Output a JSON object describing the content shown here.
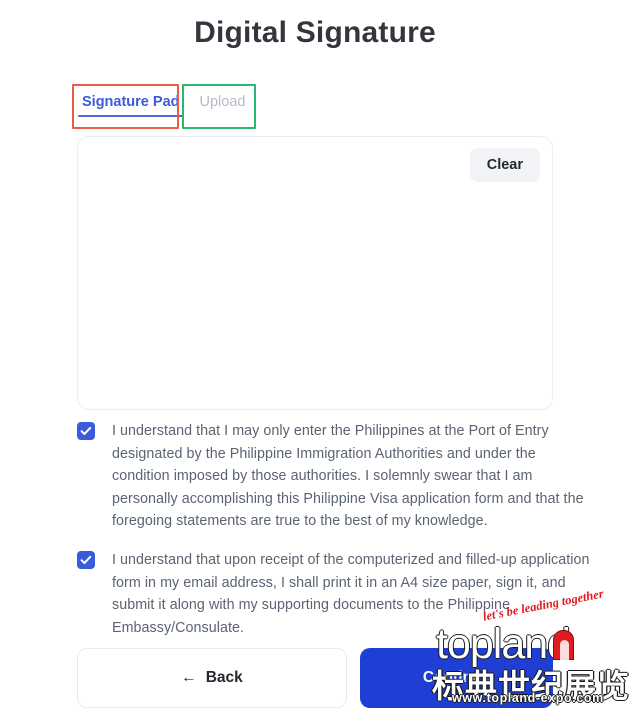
{
  "page": {
    "title": "Digital Signature",
    "background": "#ffffff"
  },
  "tabs": {
    "items": [
      {
        "label": "Signature Pad",
        "active": true,
        "annotation_color": "#ef5a43"
      },
      {
        "label": "Upload",
        "active": false,
        "annotation_color": "#2bb673"
      }
    ],
    "active_color": "#3b5bdb",
    "inactive_color": "#b6bcc6"
  },
  "signature_pad": {
    "clear_label": "Clear",
    "value": "",
    "placeholder": ""
  },
  "consents": [
    {
      "checked": true,
      "text": "I understand that I may only enter the Philippines at the Port of Entry designated by the Philippine Immigration Authorities and under the condition imposed by those authorities. I solemnly swear that I am personally accomplishing this Philippine Visa application form and that the foregoing statements are true to the best of my knowledge."
    },
    {
      "checked": true,
      "text": "I understand that upon receipt of the computerized and filled-up application form in my email address, I shall print it in an A4 size paper, sign it, and submit it along with my supporting documents to the Philippine Embassy/Consulate."
    }
  ],
  "footer": {
    "back_label": "Back",
    "back_arrow": "←",
    "continue_label": "Continue",
    "continue_color": "#1f3fd4"
  },
  "watermark": {
    "tagline": "let's be leading together",
    "brand": "topland",
    "brand_cn": "标典世纪展览",
    "url": "www.topland-expo.com",
    "accent_color": "#e01b22"
  },
  "checkbox": {
    "color": "#3b5bdb",
    "check_glyph": "check-icon"
  }
}
